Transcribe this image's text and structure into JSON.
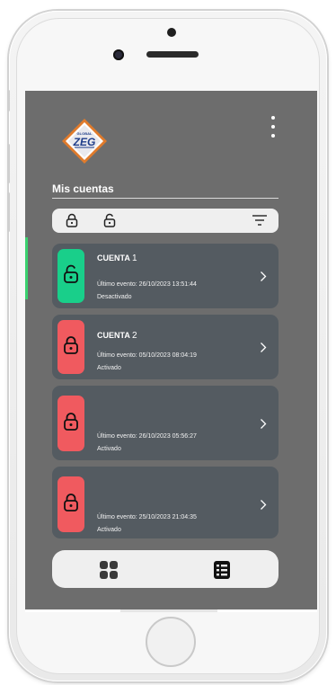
{
  "app": {
    "logo_text_small": "GLOBAL",
    "logo_text_big": "ZEG",
    "section_title": "Mis cuentas"
  },
  "filter_bar": {
    "icons": [
      "lock-closed-icon",
      "lock-open-icon",
      "sort-icon"
    ]
  },
  "accounts": [
    {
      "name": "CUENTA",
      "number": "1",
      "event": "Último evento: 26/10/2023 13:51:44",
      "state": "Desactivado",
      "status_color": "#19cf8a",
      "lock_icon": "lock-open-icon"
    },
    {
      "name": "CUENTA",
      "number": "2",
      "event": "Último evento: 05/10/2023 08:04:19",
      "state": "Activado",
      "status_color": "#f05a5f",
      "lock_icon": "lock-closed-icon"
    },
    {
      "name": "",
      "number": "",
      "event": "Último evento: 26/10/2023 05:56:27",
      "state": "Activado",
      "status_color": "#f05a5f",
      "lock_icon": "lock-closed-icon"
    },
    {
      "name": "",
      "number": "",
      "event": "Último evento: 25/10/2023 21:04:35",
      "state": "Activado",
      "status_color": "#f05a5f",
      "lock_icon": "lock-closed-icon"
    }
  ],
  "bottom_nav": {
    "tabs": [
      "grid-icon",
      "list-icon"
    ],
    "active": "list-icon"
  },
  "colors": {
    "screen_bg": "#6d6d6d",
    "card_bg": "#545b61",
    "active_green": "#19cf8a",
    "inactive_red": "#f05a5f",
    "indicator_green": "#3bd16f"
  }
}
